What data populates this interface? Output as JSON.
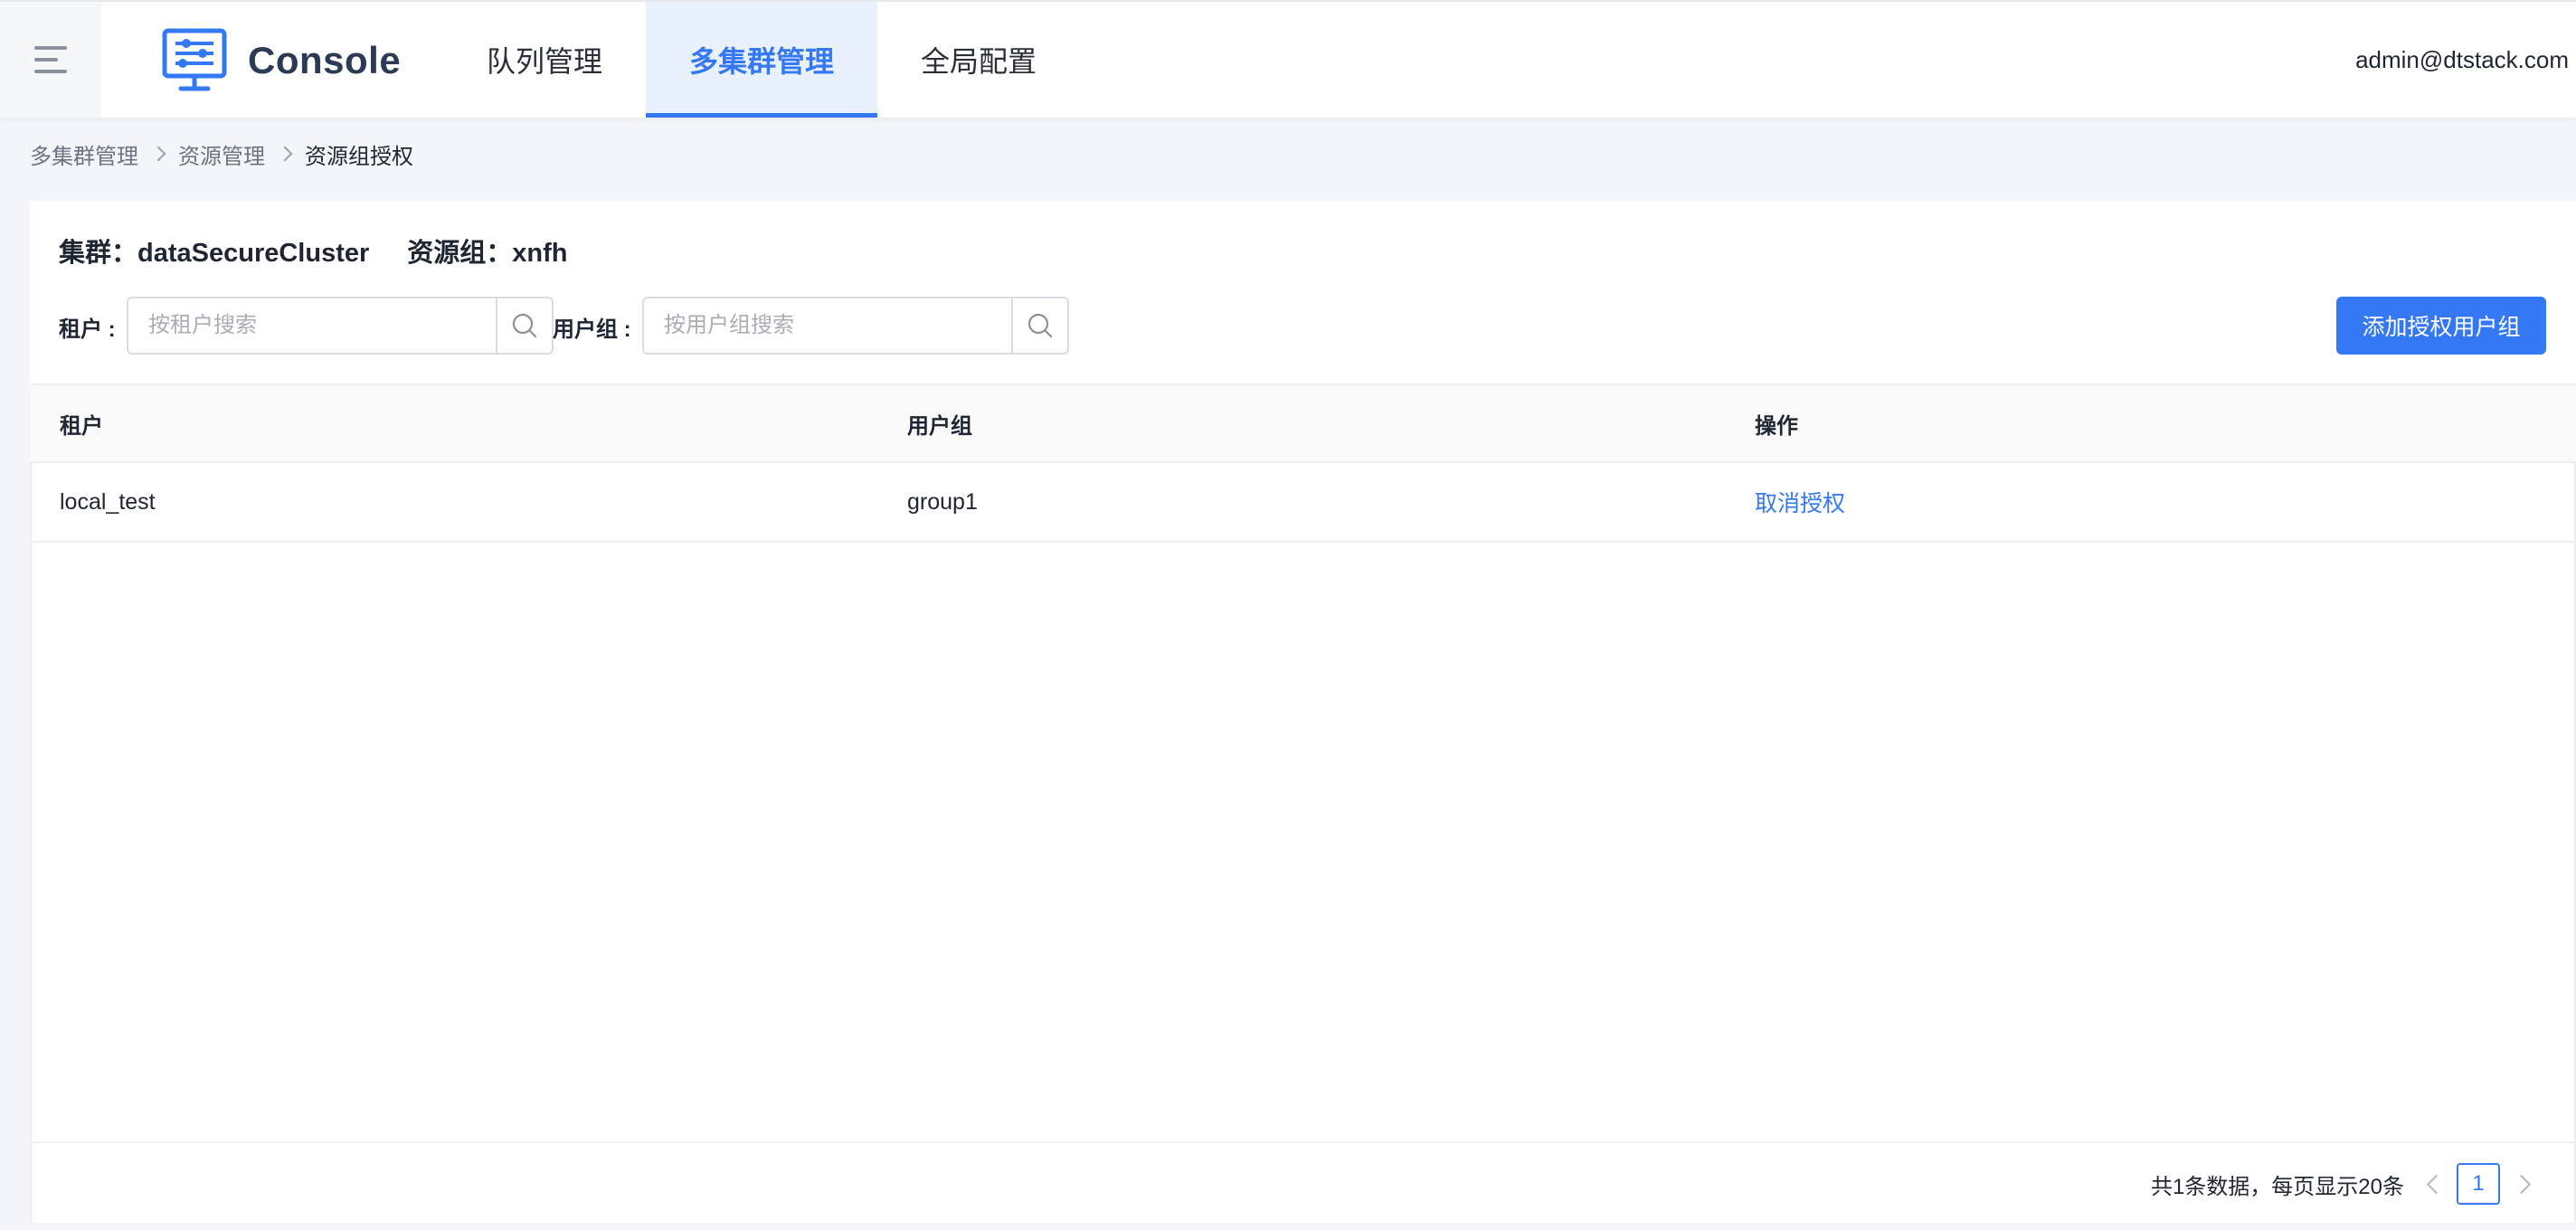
{
  "header": {
    "brand": "Console",
    "nav": [
      {
        "label": "队列管理",
        "active": false
      },
      {
        "label": "多集群管理",
        "active": true
      },
      {
        "label": "全局配置",
        "active": false
      }
    ],
    "user": "admin@dtstack.com"
  },
  "breadcrumb": [
    "多集群管理",
    "资源管理",
    "资源组授权"
  ],
  "info": {
    "cluster": "集群：dataSecureCluster",
    "resource_group": "资源组：xnfh"
  },
  "filters": {
    "tenant_label": "租户 :",
    "tenant_placeholder": "按租户搜索",
    "tenant_value": "",
    "group_label": "用户组 :",
    "group_placeholder": "按用户组搜索",
    "group_value": ""
  },
  "actions": {
    "add_button": "添加授权用户组"
  },
  "table": {
    "columns": [
      "租户",
      "用户组",
      "操作"
    ],
    "rows": [
      {
        "tenant": "local_test",
        "group": "group1",
        "action": "取消授权"
      }
    ]
  },
  "pagination": {
    "summary": "共1条数据，每页显示20条",
    "current_page": "1"
  },
  "colors": {
    "primary": "#3478f6",
    "nav_active_bg": "#e9f1fe",
    "page_bg": "#f2f5f9"
  }
}
